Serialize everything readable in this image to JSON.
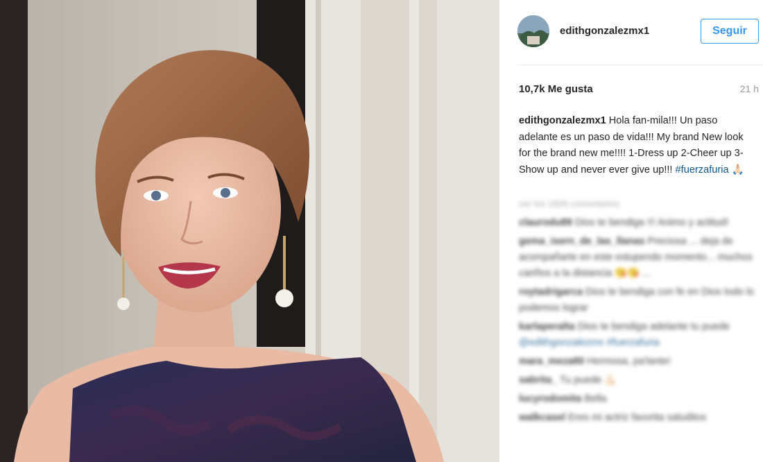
{
  "post": {
    "username": "edithgonzalezmx1",
    "follow_label": "Seguir",
    "likes": "10,7k Me gusta",
    "time": "21 h",
    "caption_user": "edithgonzalezmx1",
    "caption_text": "Hola fan-mila!!! Un paso adelante es un paso de vida!!! My brand New look for the brand new me!!!! 1-Dress up 2-Cheer up 3- Show up and never ever give up!!!",
    "caption_hashtag": "#fuerzafuria",
    "caption_emoji": "🙏🏻",
    "load_more": "ver los 1826 comentarios"
  },
  "comments": [
    {
      "user": "claurodu89",
      "text": "Dios te bendiga !!! Animo y actitud!",
      "mention": ""
    },
    {
      "user": "gema_isern_de_las_llanas",
      "text": "Preciosa ... deja de acompañarte en este estupendo momento... muchos cariños a la distancia 😘😘 ...",
      "mention": ""
    },
    {
      "user": "roytadrigarca",
      "text": "Dios te bendiga con fe en Dios todo lo podemos lograr",
      "mention": ""
    },
    {
      "user": "karlaperalta",
      "text": "Dios te bendiga adelante tu puede",
      "mention": "@edithgonzalezmx #fuerzafuria"
    },
    {
      "user": "mara_meza80",
      "text": "Hermosa, pa'lante!",
      "mention": ""
    },
    {
      "user": "sabrita_",
      "text": "Tu puede 💪🏻",
      "mention": ""
    },
    {
      "user": "lucyrodomita",
      "text": "Bella",
      "mention": ""
    },
    {
      "user": "walkcasel",
      "text": "Eres mi actriz favorita saluditos",
      "mention": ""
    }
  ]
}
